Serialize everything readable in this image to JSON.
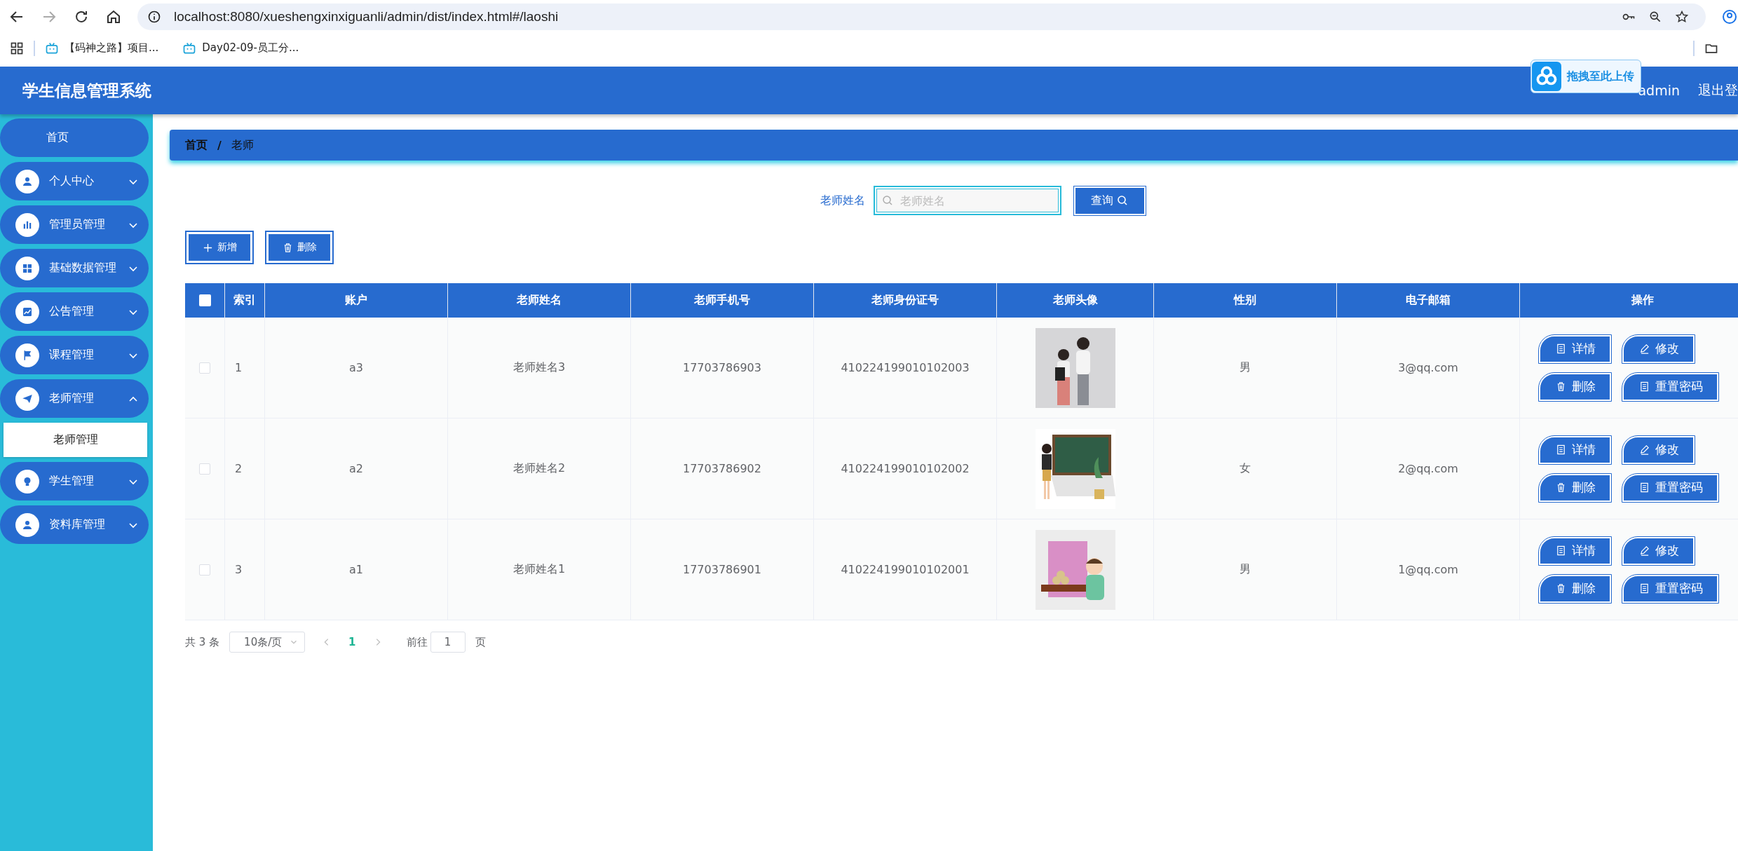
{
  "browser": {
    "url": "localhost:8080/xueshengxinxiguanli/admin/dist/index.html#/laoshi",
    "bookmarks": [
      "【码神之路】项目...",
      "Day02-09-员工分..."
    ]
  },
  "header": {
    "title": "学生信息管理系统",
    "user": "admin",
    "logout": "退出登",
    "upload_tip": "拖拽至此上传"
  },
  "sidebar": {
    "items": [
      {
        "label": "首页"
      },
      {
        "label": "个人中心",
        "expanded": false
      },
      {
        "label": "管理员管理",
        "expanded": false
      },
      {
        "label": "基础数据管理",
        "expanded": false
      },
      {
        "label": "公告管理",
        "expanded": false
      },
      {
        "label": "课程管理",
        "expanded": false
      },
      {
        "label": "老师管理",
        "expanded": true,
        "children": [
          {
            "label": "老师管理",
            "selected": true
          }
        ]
      },
      {
        "label": "学生管理",
        "expanded": false
      },
      {
        "label": "资料库管理",
        "expanded": false
      }
    ]
  },
  "breadcrumb": {
    "separator": "/",
    "items": [
      "首页",
      "老师"
    ]
  },
  "search": {
    "label": "老师姓名",
    "placeholder": "老师姓名",
    "button": "查询"
  },
  "toolbar": [
    {
      "kind": "add",
      "label": "新增"
    },
    {
      "kind": "delete",
      "label": "删除"
    }
  ],
  "table": {
    "select_all": false,
    "columns": [
      "索引",
      "账户",
      "老师姓名",
      "老师手机号",
      "老师身份证号",
      "老师头像",
      "性别",
      "电子邮箱",
      "操作"
    ],
    "rows": [
      {
        "checked": false,
        "index": "1",
        "account": "a3",
        "name": "老师姓名3",
        "phone": "17703786903",
        "id_number": "410224199010102003",
        "gender": "男",
        "email": "3@qq.com",
        "actions": [
          {
            "kind": "detail",
            "label": "详情"
          },
          {
            "kind": "edit",
            "label": "修改"
          },
          {
            "kind": "delete",
            "label": "删除"
          },
          {
            "kind": "reset",
            "label": "重置密码"
          }
        ]
      },
      {
        "checked": false,
        "index": "2",
        "account": "a2",
        "name": "老师姓名2",
        "phone": "17703786902",
        "id_number": "410224199010102002",
        "gender": "女",
        "email": "2@qq.com",
        "actions": [
          {
            "kind": "detail",
            "label": "详情"
          },
          {
            "kind": "edit",
            "label": "修改"
          },
          {
            "kind": "delete",
            "label": "删除"
          },
          {
            "kind": "reset",
            "label": "重置密码"
          }
        ]
      },
      {
        "checked": false,
        "index": "3",
        "account": "a1",
        "name": "老师姓名1",
        "phone": "17703786901",
        "id_number": "410224199010102001",
        "gender": "男",
        "email": "1@qq.com",
        "actions": [
          {
            "kind": "detail",
            "label": "详情"
          },
          {
            "kind": "edit",
            "label": "修改"
          },
          {
            "kind": "delete",
            "label": "删除"
          },
          {
            "kind": "reset",
            "label": "重置密码"
          }
        ]
      }
    ]
  },
  "pagination": {
    "total": "共 3 条",
    "page_size": "10条/页",
    "pages": [
      {
        "label": "1",
        "selected": true
      }
    ],
    "goto_label": "前往",
    "goto_value": "1",
    "goto_suffix": "页"
  }
}
